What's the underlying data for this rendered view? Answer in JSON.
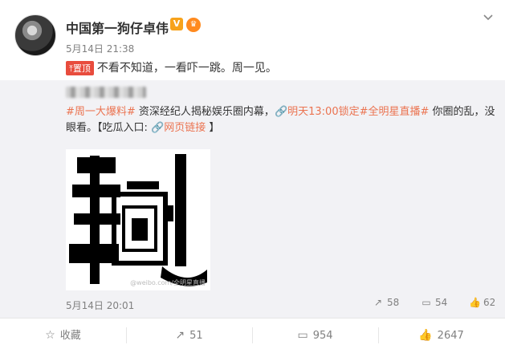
{
  "post": {
    "author": "中国第一狗仔卓伟",
    "verified_badge": "V",
    "time": "5月14日 21:38",
    "pin_label": "置顶",
    "text": "不看不知道，一看吓一跳。周一见。"
  },
  "repost": {
    "hashtag1": "#周一大爆料#",
    "body1": " 资深经纪人揭秘娱乐圈内幕，",
    "link_icon": "link-icon",
    "time_link": "明天13:00锁定",
    "hashtag2": "#全明星直播#",
    "body2": " 你圈的乱，没眼看。【吃瓜入口: ",
    "web_link": "网页链接",
    "body3": " 】",
    "watermark": "@weibo.com/全明星直播",
    "time": "5月14日 20:01",
    "reposts": "58",
    "comments": "54",
    "likes": "62"
  },
  "actions": {
    "favorite": "收藏",
    "repost": "51",
    "comment": "954",
    "like": "2647"
  },
  "colors": {
    "accent_link": "#eb7350",
    "pin_red": "#e84c3d",
    "badge_orange": "#f7a21b",
    "repost_bg": "#f2f2f5"
  }
}
